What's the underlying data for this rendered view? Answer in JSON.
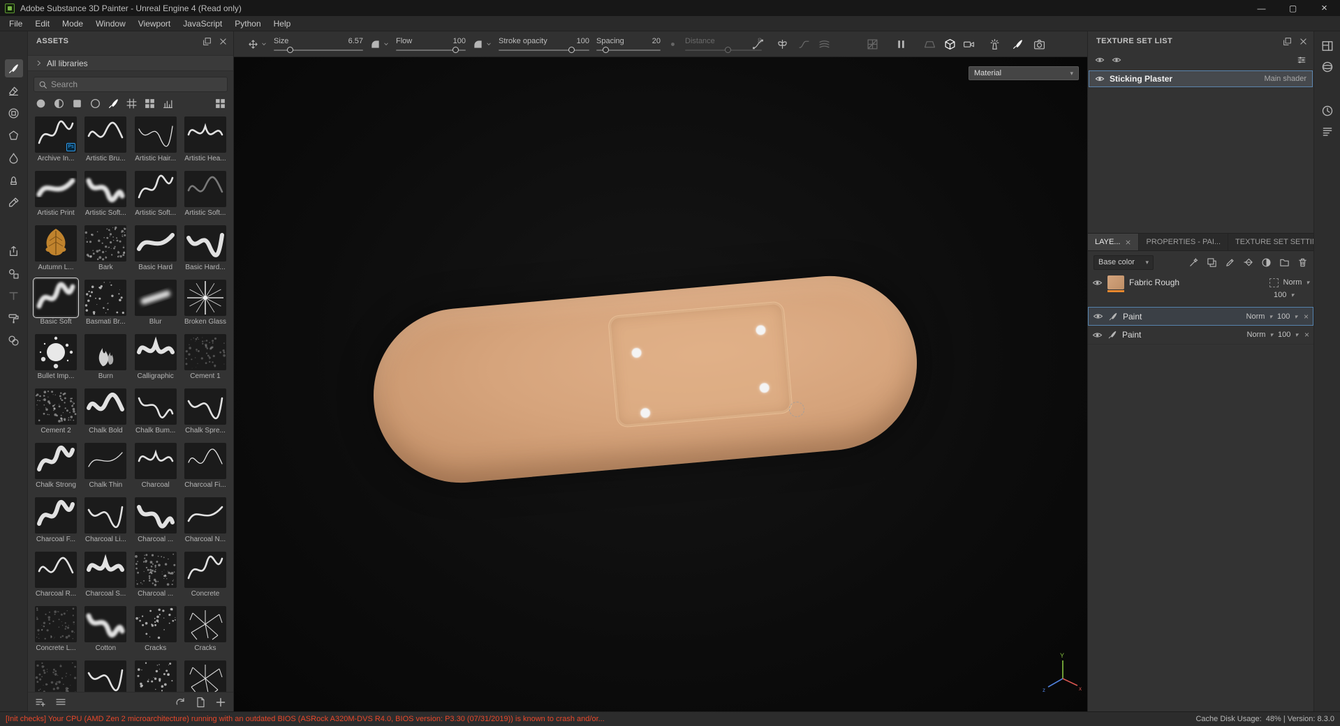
{
  "window": {
    "title": "Adobe Substance 3D Painter - Unreal Engine 4 (Read only)",
    "controls": {
      "minimize": "—",
      "maximize": "▢",
      "close": "×"
    }
  },
  "menu_bar": {
    "items": [
      "File",
      "Edit",
      "Mode",
      "Window",
      "Viewport",
      "JavaScript",
      "Python",
      "Help"
    ]
  },
  "toolbar": {
    "sliders": [
      {
        "label": "Size",
        "value": "6.57",
        "pct": 18,
        "dim": false
      },
      {
        "label": "Flow",
        "value": "100",
        "pct": 85,
        "dim": false
      },
      {
        "label": "Stroke opacity",
        "value": "100",
        "pct": 80,
        "dim": false
      },
      {
        "label": "Spacing",
        "value": "20",
        "pct": 14,
        "dim": false
      },
      {
        "label": "Distance",
        "value": "8",
        "pct": 55,
        "dim": true
      }
    ],
    "icons": [
      {
        "icon": "curve"
      },
      {
        "icon": "symmetry",
        "gap": 18
      },
      {
        "icon": "lazy",
        "dim": true,
        "gap": 14
      },
      {
        "icon": "warp",
        "dim": true,
        "gap": 12
      },
      {
        "icon": "uvgrid",
        "dim": true,
        "gap": 52
      },
      {
        "icon": "pause",
        "gap": 24
      },
      {
        "icon": "persp",
        "dim": true,
        "gap": 24
      },
      {
        "icon": "cube",
        "active": true,
        "gap": 12
      },
      {
        "icon": "videocam",
        "gap": 10
      },
      {
        "icon": "spray",
        "gap": 20
      },
      {
        "icon": "brush",
        "active": true,
        "gap": 16
      },
      {
        "icon": "camera",
        "gap": 14
      }
    ]
  },
  "left_toolbar": {
    "tools": [
      {
        "icon": "brush",
        "selected": true
      },
      {
        "icon": "eraser"
      },
      {
        "icon": "projection"
      },
      {
        "icon": "polyfill"
      },
      {
        "icon": "smudge"
      },
      {
        "icon": "clone"
      },
      {
        "icon": "dropper"
      },
      {
        "icon": "share",
        "gap_before": true
      },
      {
        "icon": "stencil"
      },
      {
        "icon": "text",
        "dim": true
      },
      {
        "icon": "roller"
      },
      {
        "icon": "spheres"
      }
    ]
  },
  "assets": {
    "title": "ASSETS",
    "header_icons": [
      "expand",
      "close"
    ],
    "library_label": "All libraries",
    "search_placeholder": "Search",
    "filters": [
      {
        "icon": "circlefill"
      },
      {
        "icon": "circlehalf"
      },
      {
        "icon": "squarefill"
      },
      {
        "icon": "circleoutline"
      },
      {
        "icon": "brush",
        "active": true
      },
      {
        "icon": "weave"
      },
      {
        "icon": "gridview"
      },
      {
        "icon": "chart"
      }
    ],
    "footer_left_icons": [
      "listadd",
      "list"
    ],
    "footer_right_icons": [
      "refresh",
      "filepage",
      "plus"
    ],
    "brushes": [
      {
        "name": "Archive In...",
        "style": "sq-a",
        "badge": "Ps"
      },
      {
        "name": "Artistic Bru...",
        "style": "sq-b"
      },
      {
        "name": "Artistic Hair...",
        "style": "sq-c thin"
      },
      {
        "name": "Artistic Hea...",
        "style": "sq-d"
      },
      {
        "name": "Artistic Print",
        "style": "sq-e soft"
      },
      {
        "name": "Artistic Soft...",
        "style": "sq-f soft"
      },
      {
        "name": "Artistic Soft...",
        "style": "sq-a"
      },
      {
        "name": "Artistic Soft...",
        "style": "sq-b dim"
      },
      {
        "name": "Autumn L...",
        "style": "leaf"
      },
      {
        "name": "Bark",
        "style": "speckle"
      },
      {
        "name": "Basic Hard",
        "style": "sq-e bold"
      },
      {
        "name": "Basic Hard...",
        "style": "sq-c bold"
      },
      {
        "name": "Basic Soft",
        "style": "sq-a soft",
        "selected": true
      },
      {
        "name": "Basmati Br...",
        "style": "grain"
      },
      {
        "name": "Blur",
        "style": "streak"
      },
      {
        "name": "Broken Glass",
        "style": "burst"
      },
      {
        "name": "Bullet Imp...",
        "style": "splat"
      },
      {
        "name": "Burn",
        "style": "flame"
      },
      {
        "name": "Calligraphic",
        "style": "sq-d bold"
      },
      {
        "name": "Cement 1",
        "style": "speckle-dim"
      },
      {
        "name": "Cement 2",
        "style": "speckle"
      },
      {
        "name": "Chalk Bold",
        "style": "sq-b bold"
      },
      {
        "name": "Chalk Bum...",
        "style": "sq-f"
      },
      {
        "name": "Chalk Spre...",
        "style": "sq-c"
      },
      {
        "name": "Chalk Strong",
        "style": "sq-a bold"
      },
      {
        "name": "Chalk Thin",
        "style": "sq-e thin"
      },
      {
        "name": "Charcoal",
        "style": "sq-d"
      },
      {
        "name": "Charcoal Fi...",
        "style": "sq-b thin"
      },
      {
        "name": "Charcoal F...",
        "style": "sq-a bold"
      },
      {
        "name": "Charcoal Li...",
        "style": "sq-c"
      },
      {
        "name": "Charcoal ...",
        "style": "sq-f bold"
      },
      {
        "name": "Charcoal N...",
        "style": "sq-e"
      },
      {
        "name": "Charcoal R...",
        "style": "sq-b"
      },
      {
        "name": "Charcoal S...",
        "style": "sq-d bold"
      },
      {
        "name": "Charcoal ...",
        "style": "speckle"
      },
      {
        "name": "Concrete",
        "style": "sq-a"
      },
      {
        "name": "Concrete L...",
        "style": "speckle-dim"
      },
      {
        "name": "Cotton",
        "style": "sq-f soft"
      },
      {
        "name": "Cracks",
        "style": "grain"
      },
      {
        "name": "Cracks",
        "style": "cracks"
      },
      {
        "name": "",
        "style": "speckle-dim"
      },
      {
        "name": "",
        "style": "sq-c"
      },
      {
        "name": "",
        "style": "grain"
      },
      {
        "name": "",
        "style": "cracks"
      }
    ]
  },
  "viewport": {
    "material_label": "Material",
    "axes": {
      "y": "Y",
      "z": "z",
      "x": "x"
    }
  },
  "texture_set_list": {
    "title": "TEXTURE SET LIST",
    "header_icons": [
      "expand",
      "close"
    ],
    "visibility_icons": [
      "eye",
      "eye"
    ],
    "filter_icon": "sliders",
    "set_name": "Sticking Plaster",
    "shader_label": "Main shader"
  },
  "panel_tabs": [
    {
      "label": "LAYE...",
      "active": true,
      "closable": true
    },
    {
      "label": "PROPERTIES - PAI...",
      "active": false
    },
    {
      "label": "TEXTURE SET SETTIN...",
      "active": false
    }
  ],
  "layers": {
    "channel": "Base color",
    "toolbar_icons": [
      "wand",
      "stampsq",
      "pencil",
      "bucket",
      "halfsphere",
      "folder",
      "trash"
    ],
    "items": [
      {
        "name": "Fabric Rough",
        "type": "fill",
        "blend": "Norm",
        "opacity": "100",
        "selected": false
      },
      {
        "name": "Paint",
        "type": "paint",
        "blend": "Norm",
        "opacity": "100",
        "selected": true
      },
      {
        "name": "Paint",
        "type": "paint",
        "blend": "Norm",
        "opacity": "100",
        "selected": false
      }
    ]
  },
  "right_rail": {
    "icons": [
      "layout",
      "sphere3d",
      "clock",
      "loglines"
    ]
  },
  "status_bar": {
    "warning": "[Init checks] Your CPU (AMD Zen 2 microarchitecture) running with an outdated BIOS (ASRock A320M-DVS R4.0, BIOS version: P3.30 (07/31/2019)) is known to crash and/or...",
    "info": "Cache Disk Usage:  48% | Version: 8.3.0"
  }
}
